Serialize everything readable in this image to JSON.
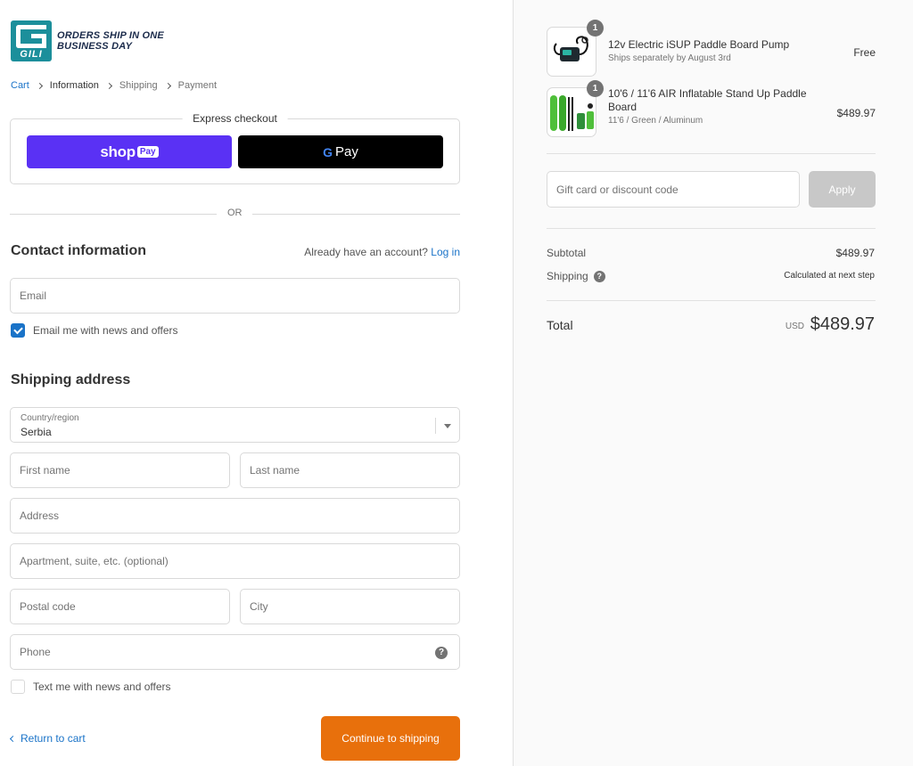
{
  "brand": {
    "logo_word": "GILI",
    "tagline_line1": "ORDERS SHIP IN ONE",
    "tagline_line2": "BUSINESS DAY",
    "accent_color": "#1c8f9b"
  },
  "breadcrumb": [
    {
      "label": "Cart"
    },
    {
      "label": "Information"
    },
    {
      "label": "Shipping"
    },
    {
      "label": "Payment"
    }
  ],
  "express_checkout": {
    "title": "Express checkout",
    "shop_pay": {
      "shop": "shop",
      "pay": "Pay",
      "color": "#5a31f4"
    },
    "google_pay": {
      "g": "G",
      "pay": "Pay"
    }
  },
  "divider_text": "OR",
  "contact": {
    "title": "Contact information",
    "account_prompt": "Already have an account?",
    "login_label": "Log in",
    "email_placeholder": "Email",
    "newsletter_label": "Email me with news and offers",
    "newsletter_checked": true
  },
  "shipping_address": {
    "title": "Shipping address",
    "country_label": "Country/region",
    "country_value": "Serbia",
    "first_name_placeholder": "First name",
    "last_name_placeholder": "Last name",
    "address_placeholder": "Address",
    "apartment_placeholder": "Apartment, suite, etc. (optional)",
    "postal_placeholder": "Postal code",
    "city_placeholder": "City",
    "phone_placeholder": "Phone",
    "help_icon": "?",
    "sms_label": "Text me with news and offers",
    "sms_checked": false
  },
  "actions": {
    "return_label": "Return to cart",
    "continue_label": "Continue to shipping",
    "continue_color": "#e8700c"
  },
  "order_summary": {
    "items": [
      {
        "quantity": "1",
        "name": "12v Electric iSUP Paddle Board Pump",
        "subtitle": "Ships separately by August 3rd",
        "price": "Free"
      },
      {
        "quantity": "1",
        "name_line1": "10'6 / 11'6 AIR Inflatable Stand Up Paddle",
        "name_line2": "Board",
        "subtitle": "11'6 / Green / Aluminum",
        "price": "$489.97"
      }
    ],
    "discount_placeholder": "Gift card or discount code",
    "apply_label": "Apply",
    "subtotal_label": "Subtotal",
    "subtotal_value": "$489.97",
    "shipping_label": "Shipping",
    "shipping_value": "Calculated at next step",
    "total_label": "Total",
    "currency": "USD",
    "total_value": "$489.97"
  }
}
